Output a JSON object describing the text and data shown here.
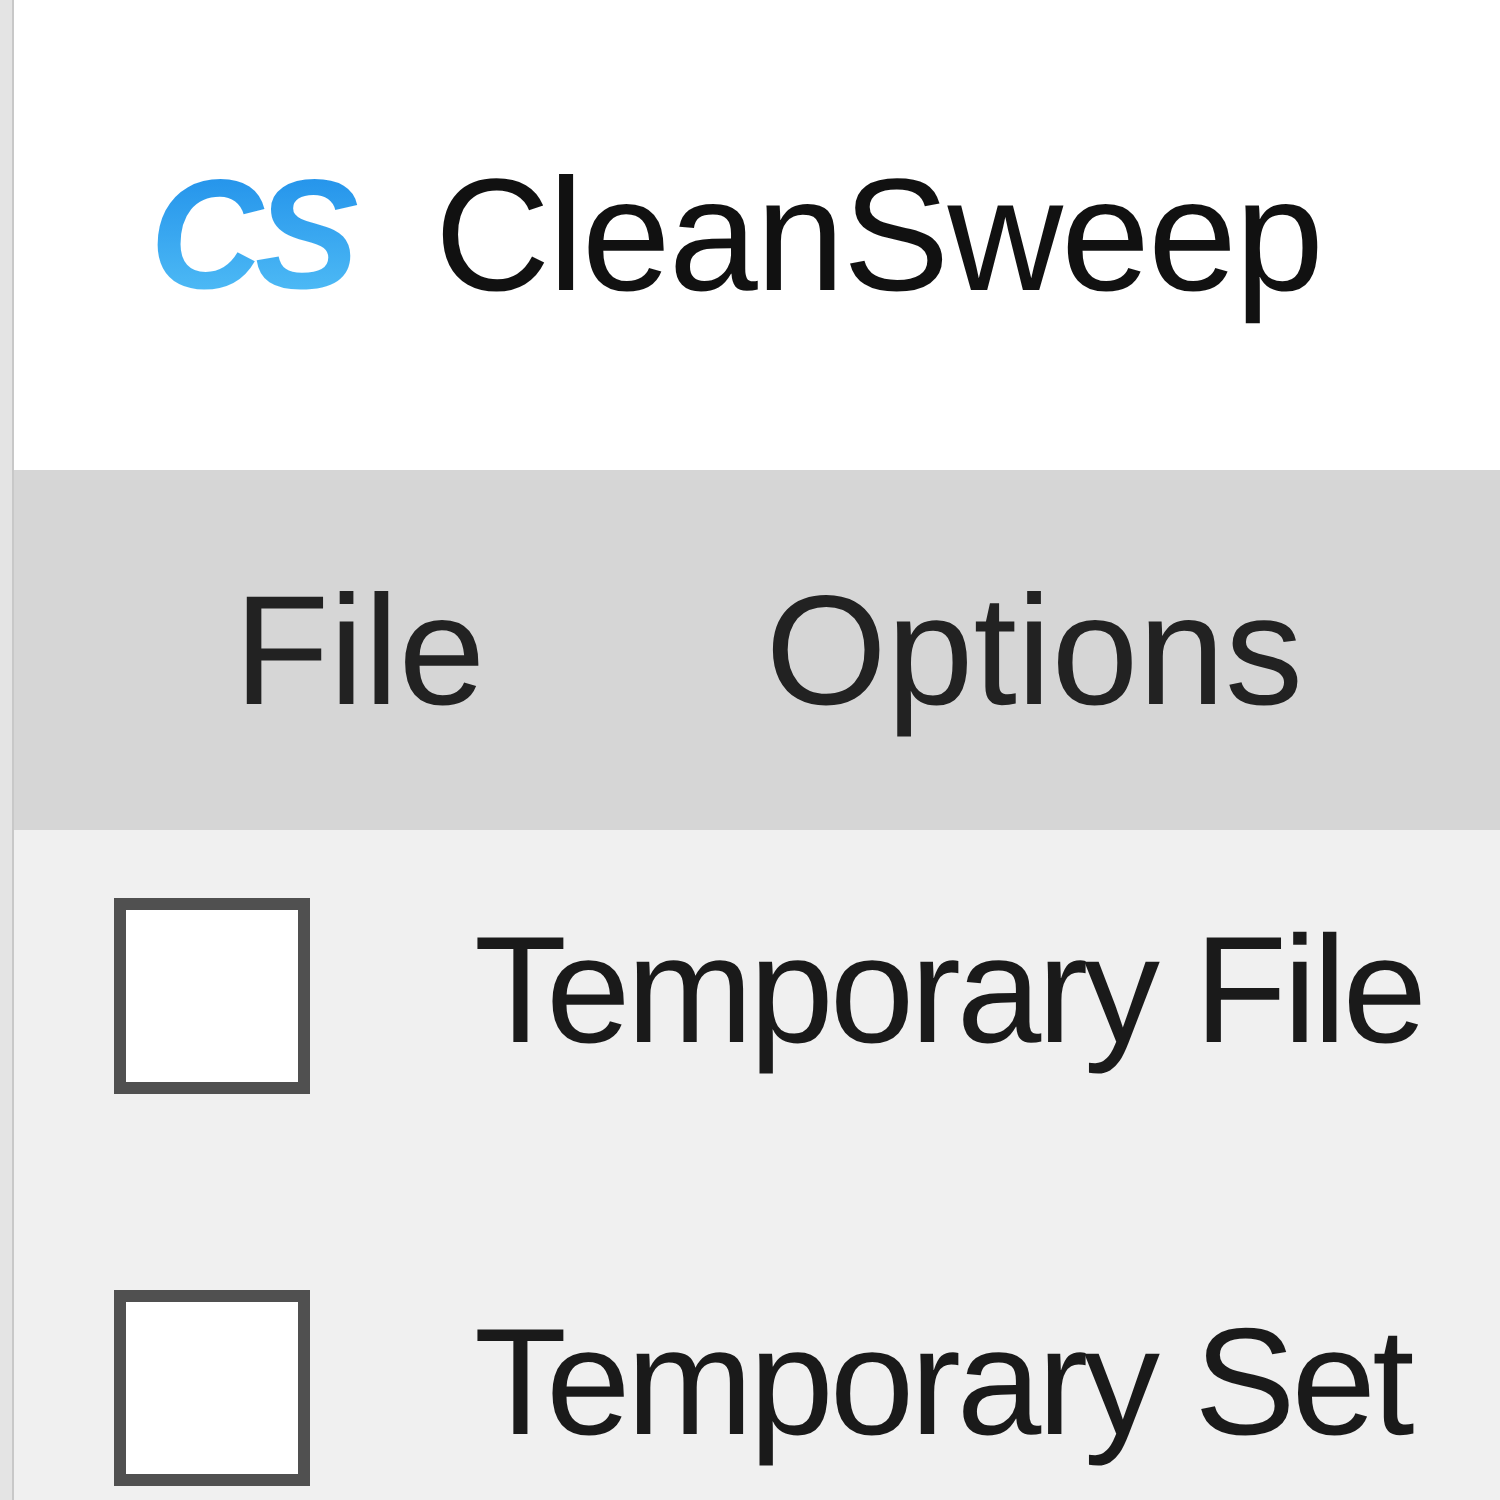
{
  "app": {
    "logo": "CS",
    "title": "CleanSweep"
  },
  "menu": [
    {
      "label": "File"
    },
    {
      "label": "Options"
    }
  ],
  "items": [
    {
      "label": "Temporary File",
      "checked": false
    },
    {
      "label": "Temporary Set",
      "checked": false
    }
  ]
}
